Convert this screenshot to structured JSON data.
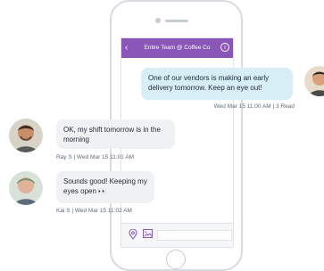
{
  "app": {
    "conversation_title": "Entire Team @ Coffee Co"
  },
  "icons": {
    "back": "chevron-left-icon",
    "info": "info-icon",
    "location": "location-pin-icon",
    "image": "image-icon"
  },
  "messages": [
    {
      "direction": "outgoing",
      "text": "One of our vendors is making an early delivery tomorrow. Keep an eye out!",
      "meta": "Wed Mar 15 11:00 AM  |  3 Read"
    },
    {
      "direction": "incoming",
      "text": "OK, my shift tomorrow is in the morning",
      "meta": "Ray S  |  Wed Mar 15 11:01 AM"
    },
    {
      "direction": "incoming",
      "text": "Sounds good! Keeping my eyes open",
      "emoji": "👀",
      "meta": "Kai S  |  Wed Mar 15 11:02 AM"
    }
  ]
}
